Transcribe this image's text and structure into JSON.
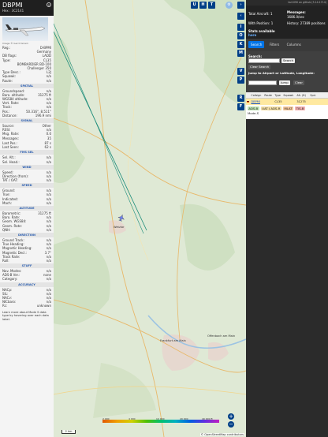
{
  "aircraft": {
    "callsign": "DBPMI",
    "hex_line": "Hex : 3C2141",
    "close": "×",
    "photo_credit": "Image © Gerrit Griem"
  },
  "info_rows": [
    {
      "k": "Reg.:",
      "v": "D-BPMI"
    },
    {
      "k": "",
      "v": "Germany"
    },
    {
      "k": "DB flags:",
      "v": "LADD"
    },
    {
      "k": "Type:",
      "v": "CL35"
    },
    {
      "k": "",
      "v": "BOMBARDIER BD-100"
    },
    {
      "k": "",
      "v": "Challenger 350"
    },
    {
      "k": "Type Desc.:",
      "v": "L2J"
    },
    {
      "k": "Squawk:",
      "v": "n/a"
    },
    {
      "k": "Route:",
      "v": "n/a"
    }
  ],
  "sections": {
    "spatial": "SPATIAL",
    "signal": "SIGNAL",
    "fms": "FMS SEL",
    "wind": "WIND",
    "speed": "SPEED",
    "altitude": "ALTITUDE",
    "direction": "DIRECTION",
    "stuff": "STUFF",
    "accuracy": "ACCURACY"
  },
  "spatial_rows": [
    {
      "k": "Groundspeed:",
      "v": "n/a"
    },
    {
      "k": "Baro. altitude:",
      "v": "31275 ft"
    },
    {
      "k": "WGS84 altitude:",
      "v": "n/a"
    },
    {
      "k": "Vert. Rate:",
      "v": "n/a"
    },
    {
      "k": "Track:",
      "v": "n/a"
    },
    {
      "k": "Pos.:",
      "v": "50.316°, 8.511°"
    },
    {
      "k": "Distance:",
      "v": "196.9 nmi"
    }
  ],
  "signal_rows": [
    {
      "k": "Source:",
      "v": "Other"
    },
    {
      "k": "RSSI:",
      "v": "n/a"
    },
    {
      "k": "Msg. Rate:",
      "v": "0.0"
    },
    {
      "k": "Messages:",
      "v": "35"
    },
    {
      "k": "Last Pos.:",
      "v": "87 s"
    },
    {
      "k": "Last Seen:",
      "v": "62 s"
    }
  ],
  "fms_rows": [
    {
      "k": "Sel. Alt.:",
      "v": "n/a"
    },
    {
      "k": "Sel. Head.:",
      "v": "n/a"
    }
  ],
  "wind_rows": [
    {
      "k": "Speed:",
      "v": "n/a"
    },
    {
      "k": "Direction (from):",
      "v": "n/a"
    },
    {
      "k": "TAT / OAT:",
      "v": "n/a"
    }
  ],
  "speed_rows": [
    {
      "k": "Ground:",
      "v": "n/a"
    },
    {
      "k": "True:",
      "v": "n/a"
    },
    {
      "k": "Indicated:",
      "v": "n/a"
    },
    {
      "k": "Mach:",
      "v": "n/a"
    }
  ],
  "altitude_rows": [
    {
      "k": "Barometric:",
      "v": "31275 ft"
    },
    {
      "k": "Baro. Rate:",
      "v": "n/a"
    },
    {
      "k": "Geom. WGS84:",
      "v": "n/a"
    },
    {
      "k": "Geom. Rate:",
      "v": "n/a"
    },
    {
      "k": "QNH:",
      "v": "n/a"
    }
  ],
  "direction_rows": [
    {
      "k": "Ground Track:",
      "v": "n/a"
    },
    {
      "k": "True Heading:",
      "v": "n/a"
    },
    {
      "k": "Magnetic Heading:",
      "v": "n/a"
    },
    {
      "k": "Magnetic Decl.:",
      "v": "3.7°"
    },
    {
      "k": "Track Rate:",
      "v": "n/a"
    },
    {
      "k": "Roll:",
      "v": "n/a"
    }
  ],
  "stuff_rows": [
    {
      "k": "Nav. Modes:",
      "v": "n/a"
    },
    {
      "k": "ADS-B Ver.:",
      "v": "none"
    },
    {
      "k": "Category:",
      "v": "n/a"
    }
  ],
  "accuracy_rows": [
    {
      "k": "NACp:",
      "v": "n/a"
    },
    {
      "k": "SIL:",
      "v": "n/a"
    },
    {
      "k": "NACv:",
      "v": "n/a"
    },
    {
      "k": "NICbaro:",
      "v": "n/a"
    },
    {
      "k": "Rc:",
      "v": "unknown"
    }
  ],
  "footer": "Learn more about Mode S data type by hovering over each data label.",
  "map": {
    "top_buttons": [
      "U",
      "H",
      "T"
    ],
    "side_buttons": [
      "I",
      "O",
      "K",
      "M",
      "V",
      "P",
      "R",
      "F"
    ],
    "arrow_right": "›",
    "arrow_left": "‹",
    "arrow_left_top": "◁",
    "arrow_right_top": "▷",
    "zoom_in": "+",
    "zoom_out": "−",
    "scale": "2 km",
    "alt_labels": [
      "2 000",
      "4 000",
      "10 000",
      "20 000",
      "40 000 ft"
    ],
    "attribution": "© OpenStreetMap contributors",
    "cities": [
      "Frankfurt am Main",
      "Offenbach am Main",
      "Wetzlar"
    ]
  },
  "right": {
    "link": "tar1090 on github (3.14.1714)",
    "total_label": "Total Aircraft:",
    "total_value": "1",
    "with_pos_label": "With Position:",
    "with_pos_value": "1",
    "stats_label": "Stats available",
    "stats_link": "here",
    "messages_label": "Messages:",
    "messages_value": "1686.0/sec",
    "history_label": "History:",
    "history_value": "27389 positions",
    "tabs": [
      "Search",
      "Filters",
      "Columns"
    ],
    "search_label": "Search:",
    "search_button": "Search",
    "clear_button": "Clear Search",
    "jump_label": "Jump to Airport or Latitude, Longitude:",
    "jump_button": "Jump",
    "clear_small": "Clear",
    "columns": [
      "",
      "Callsign",
      "Route",
      "Type",
      "Squawk",
      "Alt. (ft)",
      "Spd."
    ],
    "row": {
      "callsign": "DBPMI",
      "type": "CL35",
      "alt": "31275"
    },
    "sources": [
      "ADS-B",
      "UAT / ADS-R",
      "MLAT",
      "TIS-B"
    ],
    "mode_s": "Mode-S"
  },
  "colors": {
    "brand": "#003f87",
    "map_green": "#dfe9d5",
    "track_line": "#1d8c7a",
    "selected_row": "#ffe9a0",
    "tab_active": "#0073e6"
  }
}
